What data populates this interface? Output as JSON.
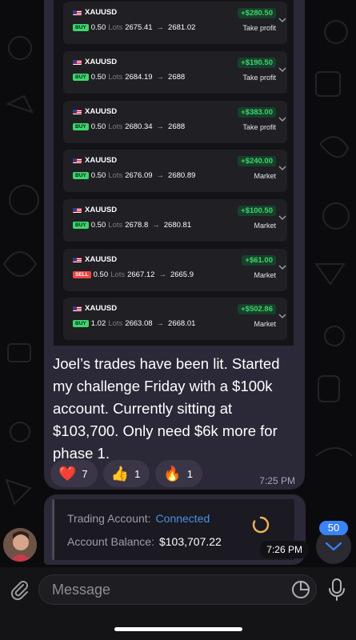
{
  "trades": [
    {
      "symbol": "XAUUSD",
      "side": "BUY",
      "side_class": "buy",
      "lots_value": "0.50",
      "lots_label": "Lots",
      "entry": "2675.41",
      "exit": "2681.02",
      "profit": "+$280.50",
      "close_reason": "Take profit"
    },
    {
      "symbol": "XAUUSD",
      "side": "BUY",
      "side_class": "buy",
      "lots_value": "0.50",
      "lots_label": "Lots",
      "entry": "2684.19",
      "exit": "2688",
      "profit": "+$190.50",
      "close_reason": "Take profit"
    },
    {
      "symbol": "XAUUSD",
      "side": "BUY",
      "side_class": "buy",
      "lots_value": "0.50",
      "lots_label": "Lots",
      "entry": "2680.34",
      "exit": "2688",
      "profit": "+$383.00",
      "close_reason": "Take profit"
    },
    {
      "symbol": "XAUUSD",
      "side": "BUY",
      "side_class": "buy",
      "lots_value": "0.50",
      "lots_label": "Lots",
      "entry": "2676.09",
      "exit": "2680.89",
      "profit": "+$240.00",
      "close_reason": "Market"
    },
    {
      "symbol": "XAUUSD",
      "side": "BUY",
      "side_class": "buy",
      "lots_value": "0.50",
      "lots_label": "Lots",
      "entry": "2678.8",
      "exit": "2680.81",
      "profit": "+$100.50",
      "close_reason": "Market"
    },
    {
      "symbol": "XAUUSD",
      "side": "SELL",
      "side_class": "sell",
      "lots_value": "0.50",
      "lots_label": "Lots",
      "entry": "2667.12",
      "exit": "2665.9",
      "profit": "+$61.00",
      "close_reason": "Market"
    },
    {
      "symbol": "XAUUSD",
      "side": "BUY",
      "side_class": "buy",
      "lots_value": "1.02",
      "lots_label": "Lots",
      "entry": "2663.08",
      "exit": "2668.01",
      "profit": "+$502.86",
      "close_reason": "Market"
    }
  ],
  "message1": {
    "text": "Joel’s trades have been lit. Started my challenge Friday with a $100k account. Currently sitting at $103,700. Only need $6k more for phase 1.",
    "time": "7:25 PM",
    "reactions": [
      {
        "emoji": "❤️",
        "count": "7"
      },
      {
        "emoji": "👍",
        "count": "1"
      },
      {
        "emoji": "🔥",
        "count": "1"
      }
    ]
  },
  "message2": {
    "account_label": "Trading Account:",
    "account_status": "Connected",
    "balance_label": "Account Balance:",
    "balance_value": "$103,707.22",
    "time": "7:26 PM"
  },
  "unread_count": "50",
  "composer": {
    "placeholder": "Message"
  },
  "colors": {
    "accent": "#3b82f6",
    "profit": "#3dd56d",
    "connected": "#4a90e2",
    "bubble": "#2b2838"
  },
  "icons": [
    "us-flag-icon",
    "chevron-down-icon",
    "attach-icon",
    "sticker-icon",
    "mic-icon",
    "spinner-icon",
    "scroll-down-icon"
  ]
}
